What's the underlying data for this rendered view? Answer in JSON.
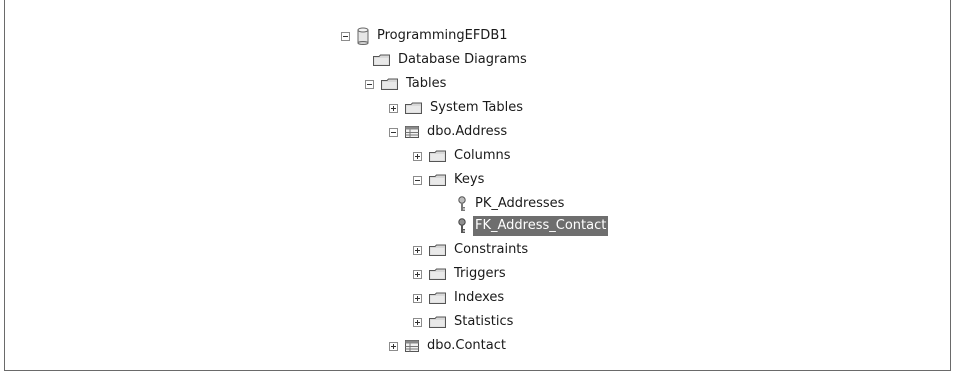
{
  "tree": {
    "database": "ProgrammingEFDB1",
    "database_diagrams": "Database Diagrams",
    "tables": "Tables",
    "system_tables": "System Tables",
    "address_table": "dbo.Address",
    "columns": "Columns",
    "keys": "Keys",
    "pk_addresses": "PK_Addresses",
    "fk_address_contact": "FK_Address_Contact",
    "constraints": "Constraints",
    "triggers": "Triggers",
    "indexes": "Indexes",
    "statistics": "Statistics",
    "contact_table": "dbo.Contact"
  },
  "icons": {
    "database": "database-icon",
    "folder": "folder-icon",
    "table": "table-icon",
    "key": "key-icon",
    "expand": "expand-icon",
    "collapse": "collapse-icon"
  },
  "colors": {
    "selection_bg": "#6e6e6e",
    "selection_text": "#ffffff",
    "folder_fill": "#d8d8d8",
    "text": "#1a1a1a"
  },
  "selected_node": "FK_Address_Contact"
}
